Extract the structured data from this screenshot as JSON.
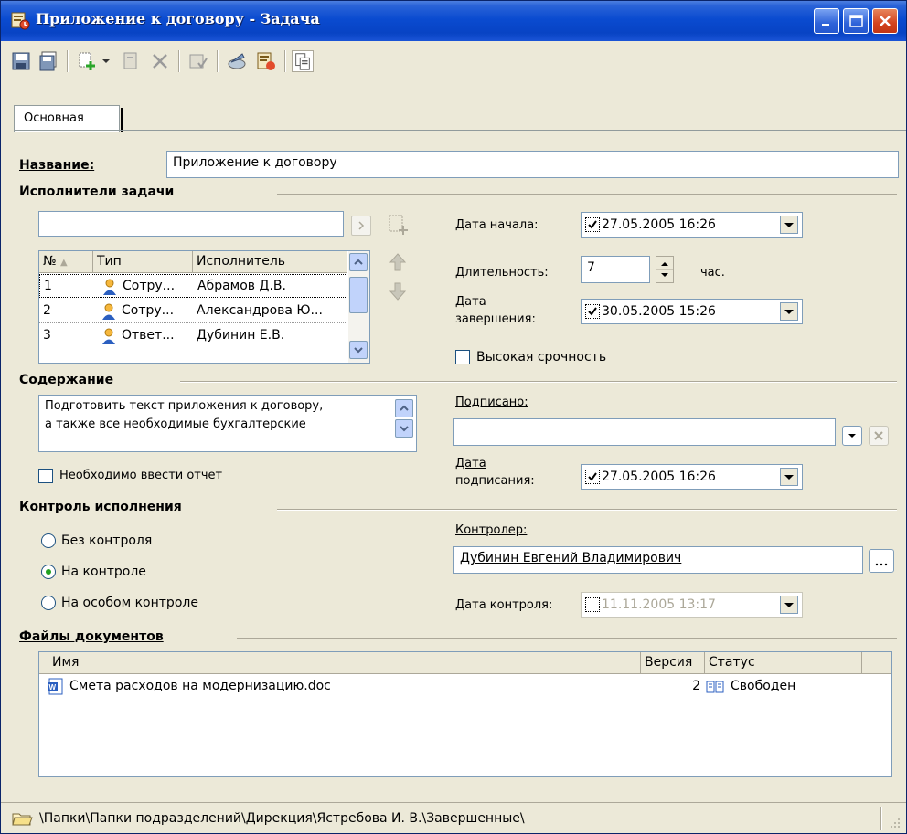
{
  "window": {
    "title": "Приложение к договору - Задача"
  },
  "tabs": [
    {
      "label": "Основная"
    }
  ],
  "name_field": {
    "label": "Название:",
    "value": "Приложение к договору"
  },
  "executors": {
    "section_label": "Исполнители задачи",
    "search_value": "",
    "columns": [
      "№",
      "Тип",
      "Исполнитель"
    ],
    "rows": [
      {
        "num": "1",
        "type": "Сотру...",
        "name": "Абрамов Д.В."
      },
      {
        "num": "2",
        "type": "Сотру...",
        "name": "Александрова Ю..."
      },
      {
        "num": "3",
        "type": "Ответ...",
        "name": "Дубинин Е.В."
      }
    ]
  },
  "dates": {
    "start_label": "Дата начала:",
    "start_value": "27.05.2005 16:26",
    "duration_label": "Длительность:",
    "duration_value": "7",
    "duration_unit": "час.",
    "end_label_line1": "Дата",
    "end_label_line2": "завершения:",
    "end_value": "30.05.2005 15:26",
    "urgent_label": "Высокая срочность"
  },
  "content": {
    "section_label": "Содержание",
    "text_line1": "Подготовить текст приложения к договору,",
    "text_line2": "а также все необходимые бухгалтерские",
    "report_label": "Необходимо ввести отчет"
  },
  "signed": {
    "label": "Подписано:",
    "value": "",
    "date_label_line1": "Дата",
    "date_label_line2": "подписания:",
    "date_value": "27.05.2005 16:26"
  },
  "control": {
    "section_label": "Контроль исполнения",
    "options": [
      {
        "label": "Без контроля",
        "selected": false
      },
      {
        "label": "На контроле",
        "selected": true
      },
      {
        "label": "На особом контроле",
        "selected": false
      }
    ],
    "controller_label": "Контролер:",
    "controller_value": "Дубинин Евгений Владимирович",
    "control_date_label": "Дата контроля:",
    "control_date_value": "11.11.2005 13:17"
  },
  "files": {
    "section_label": "Файлы документов",
    "columns": [
      "Имя",
      "Версия",
      "Статус"
    ],
    "rows": [
      {
        "name": "Смета расходов на модернизацию.doc",
        "version": "2",
        "status": "Свободен"
      }
    ]
  },
  "statusbar": {
    "path": "\\Папки\\Папки подразделений\\Дирекция\\Ястребова И. В.\\Завершенные\\"
  }
}
